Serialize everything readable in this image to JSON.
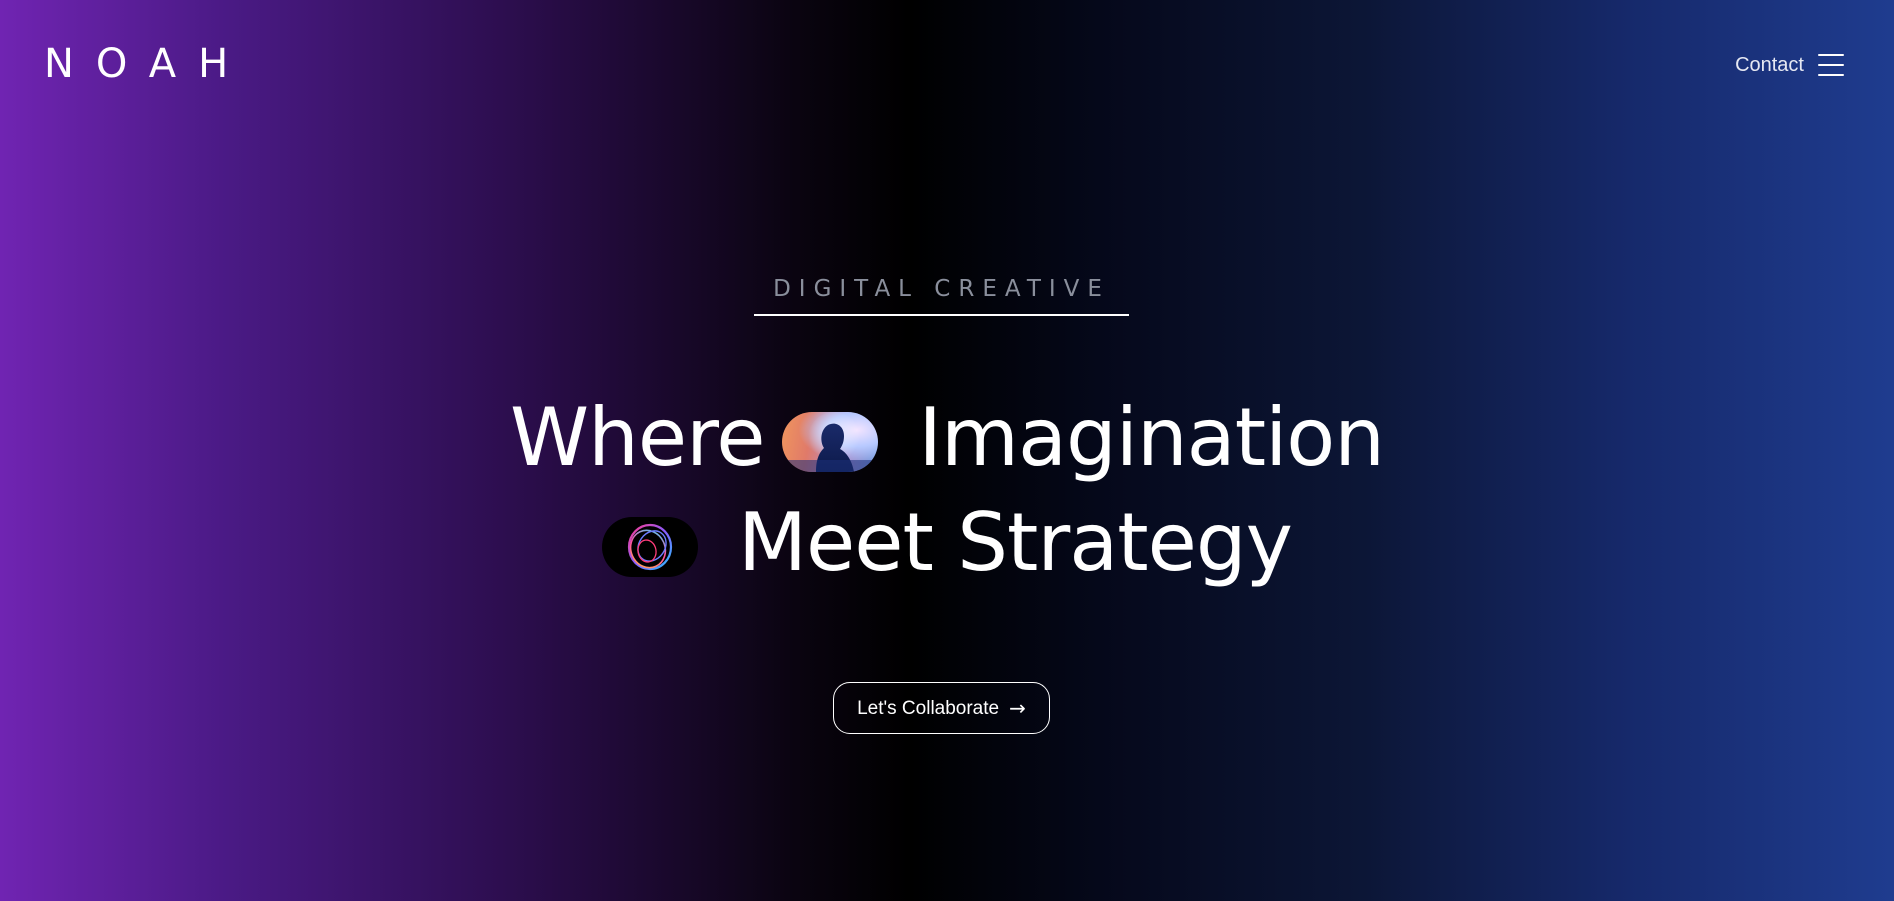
{
  "brand": {
    "logo_text": "NOAH"
  },
  "nav": {
    "contact_label": "Contact",
    "menu_icon": "hamburger-menu-icon"
  },
  "hero": {
    "eyebrow": "DIGITAL CREATIVE",
    "headline_line1_word1": "Where",
    "headline_line1_word2": "Imagination",
    "headline_line2": "Meet Strategy",
    "image_pill_1": "portrait-silhouette-image",
    "image_pill_2": "glowing-orb-image"
  },
  "cta": {
    "label": "Let's Collaborate",
    "arrow": "→"
  },
  "colors": {
    "gradient_left": "#7024b2",
    "gradient_center": "#000000",
    "gradient_right": "#1f3c8f",
    "eyebrow_text": "#8a8f9c",
    "text": "#ffffff"
  }
}
